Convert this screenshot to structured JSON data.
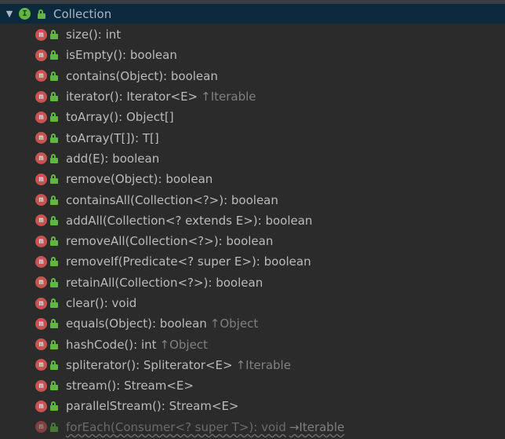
{
  "root": {
    "label": "Collection",
    "expand_glyph": "▼",
    "badge_letter": "I",
    "icon": "interface-icon"
  },
  "methods": [
    {
      "signature": "size(): int",
      "origin": "",
      "badge": "m",
      "inherited": false
    },
    {
      "signature": "isEmpty(): boolean",
      "origin": "",
      "badge": "m",
      "inherited": false
    },
    {
      "signature": "contains(Object): boolean",
      "origin": "",
      "badge": "m",
      "inherited": false
    },
    {
      "signature": "iterator(): Iterator<E>",
      "origin": "↑Iterable",
      "badge": "m",
      "inherited": false
    },
    {
      "signature": "toArray(): Object[]",
      "origin": "",
      "badge": "m",
      "inherited": false
    },
    {
      "signature": "toArray(T[]): T[]",
      "origin": "",
      "badge": "m",
      "inherited": false
    },
    {
      "signature": "add(E): boolean",
      "origin": "",
      "badge": "m",
      "inherited": false
    },
    {
      "signature": "remove(Object): boolean",
      "origin": "",
      "badge": "m",
      "inherited": false
    },
    {
      "signature": "containsAll(Collection<?>): boolean",
      "origin": "",
      "badge": "m",
      "inherited": false
    },
    {
      "signature": "addAll(Collection<? extends E>): boolean",
      "origin": "",
      "badge": "m",
      "inherited": false
    },
    {
      "signature": "removeAll(Collection<?>): boolean",
      "origin": "",
      "badge": "m",
      "inherited": false
    },
    {
      "signature": "removeIf(Predicate<? super E>): boolean",
      "origin": "",
      "badge": "m",
      "inherited": false
    },
    {
      "signature": "retainAll(Collection<?>): boolean",
      "origin": "",
      "badge": "m",
      "inherited": false
    },
    {
      "signature": "clear(): void",
      "origin": "",
      "badge": "m",
      "inherited": false
    },
    {
      "signature": "equals(Object): boolean",
      "origin": "↑Object",
      "badge": "m",
      "inherited": false
    },
    {
      "signature": "hashCode(): int",
      "origin": "↑Object",
      "badge": "m",
      "inherited": false
    },
    {
      "signature": "spliterator(): Spliterator<E>",
      "origin": "↑Iterable",
      "badge": "m",
      "inherited": false
    },
    {
      "signature": "stream(): Stream<E>",
      "origin": "",
      "badge": "m",
      "inherited": false
    },
    {
      "signature": "parallelStream(): Stream<E>",
      "origin": "",
      "badge": "m",
      "inherited": false
    },
    {
      "signature": "forEach(Consumer<? super T>): void",
      "origin": "→Iterable",
      "badge": "m",
      "inherited": true
    }
  ],
  "colors": {
    "background": "#2b2b2b",
    "selection": "#0d293e",
    "method_badge": "#c75450",
    "interface_badge": "#62b543",
    "lock": "#62b543"
  }
}
